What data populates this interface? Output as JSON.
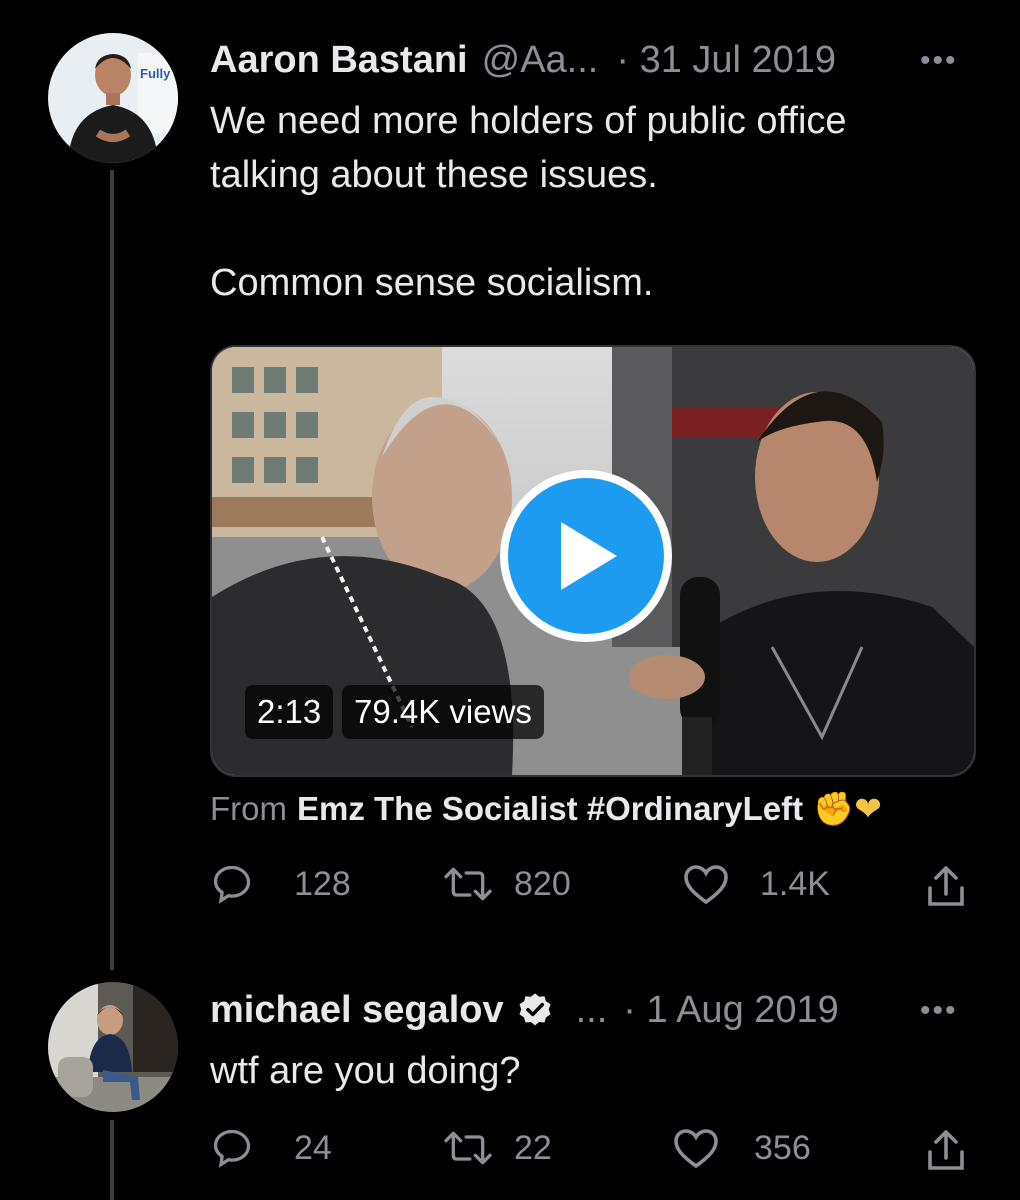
{
  "tweets": [
    {
      "name": "Aaron Bastani",
      "handle": "@Aa...",
      "date": "· 31 Jul 2019",
      "more": "•••",
      "text_lines": [
        "We need more holders of public office",
        "talking about these issues.",
        "",
        "Common sense socialism."
      ],
      "avatar_sign_text": "Fully",
      "video": {
        "duration": "2:13",
        "views": "79.4K views"
      },
      "from_prefix": "From",
      "from_source": "Emz The Socialist #OrdinaryLeft",
      "from_emoji": "✊❤",
      "replies": "128",
      "retweets": "820",
      "likes": "1.4K"
    },
    {
      "name": "michael segalov",
      "handle": "...",
      "date": "· 1 Aug 2019",
      "more": "•••",
      "verified": true,
      "text": "wtf are you doing?",
      "replies": "24",
      "retweets": "22",
      "likes": "356"
    }
  ],
  "colors": {
    "background": "#000000",
    "text": "#e7e9ea",
    "muted": "#8b9096",
    "accent_blue": "#1d9bf0",
    "thread_line": "#3a3d40"
  },
  "icons": [
    "reply-icon",
    "retweet-icon",
    "like-icon",
    "share-icon",
    "play-icon",
    "verified-badge-icon",
    "more-icon"
  ]
}
